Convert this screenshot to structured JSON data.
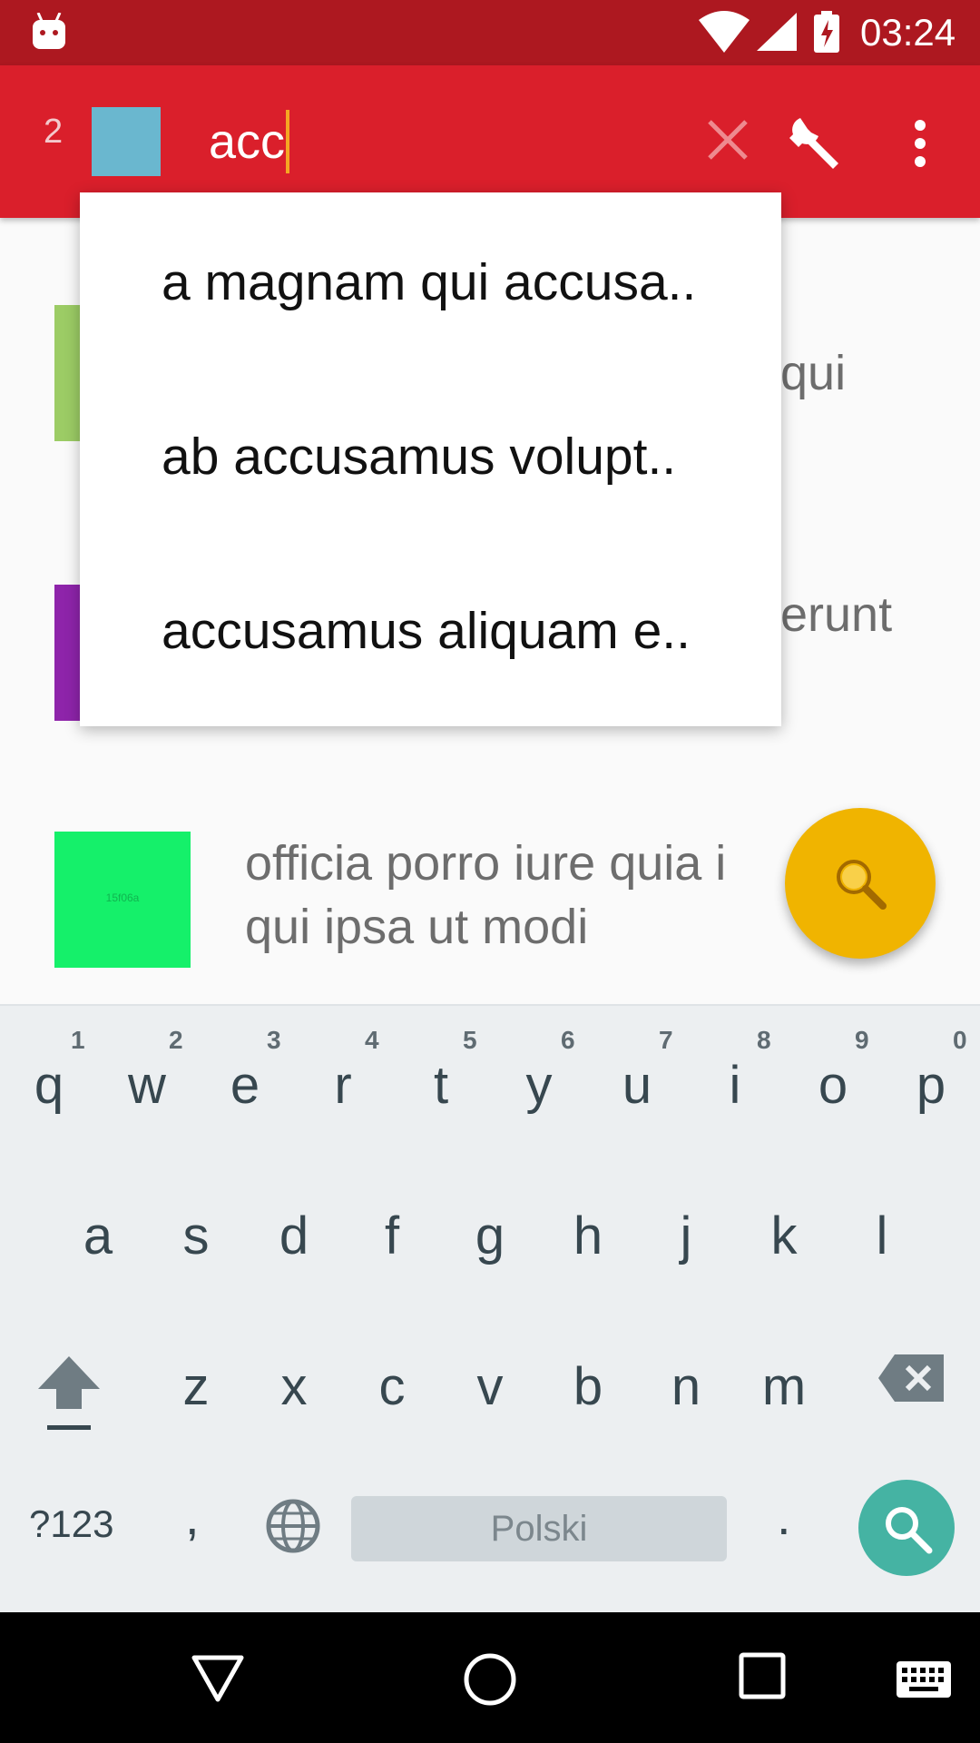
{
  "status_bar": {
    "time": "03:24"
  },
  "toolbar": {
    "result_count": "2",
    "search_query": "acc",
    "actions": [
      "close-icon",
      "wrench-icon",
      "more-vert-icon"
    ]
  },
  "suggestions": [
    "a magnam qui accusa..",
    "ab accusamus volupt..",
    "accusamus aliquam e.."
  ],
  "list": {
    "items": [
      {
        "title": "qui",
        "color": "#9ccc65"
      },
      {
        "title": "erunt",
        "color": "#8e24aa"
      },
      {
        "title": "officia porro iure quia i\nqui ipsa ut modi",
        "color": "#15f06a",
        "swatch_text": "15f06a"
      }
    ]
  },
  "fab": {
    "icon": "search-icon",
    "color": "#f0b400"
  },
  "keyboard": {
    "row1": [
      "q",
      "w",
      "e",
      "r",
      "t",
      "y",
      "u",
      "i",
      "o",
      "p"
    ],
    "row1_hints": [
      "1",
      "2",
      "3",
      "4",
      "5",
      "6",
      "7",
      "8",
      "9",
      "0"
    ],
    "row2": [
      "a",
      "s",
      "d",
      "f",
      "g",
      "h",
      "j",
      "k",
      "l"
    ],
    "row3": [
      "z",
      "x",
      "c",
      "v",
      "b",
      "n",
      "m"
    ],
    "symbols_label": "?123",
    "comma": ",",
    "space_label": "Polski",
    "period": "."
  },
  "colors": {
    "toolbar": "#da1f2b",
    "status_bar": "#ad1820",
    "search_key": "#45b3a3"
  }
}
